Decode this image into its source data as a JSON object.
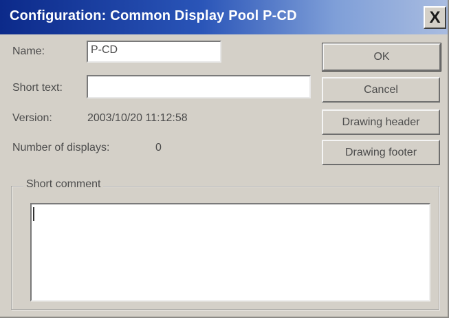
{
  "window": {
    "title": "Configuration: Common Display Pool P-CD",
    "close_symbol": "X",
    "titlebar_color": "#0c2a8a"
  },
  "form": {
    "name_label": "Name:",
    "name_value": "P-CD",
    "short_text_label": "Short text:",
    "short_text_value": "",
    "version_label": "Version:",
    "version_value": "2003/10/20 11:12:58",
    "displays_label": "Number of displays:",
    "displays_value": "0",
    "comment_group_label": "Short comment",
    "comment_value": ""
  },
  "buttons": {
    "ok": "OK",
    "cancel": "Cancel",
    "drawing_header": "Drawing header",
    "drawing_footer": "Drawing footer"
  },
  "icons": {
    "close": "close-icon"
  }
}
